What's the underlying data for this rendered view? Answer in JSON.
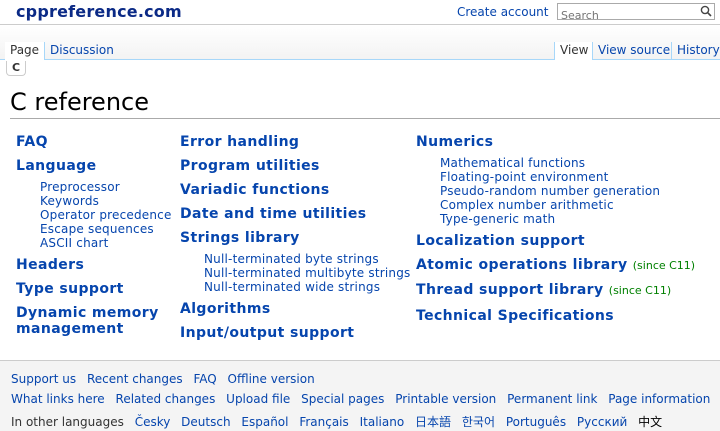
{
  "header": {
    "logo": "cppreference.com",
    "create_account": "Create account",
    "search_placeholder": "Search"
  },
  "tabs": {
    "left": [
      "Page",
      "Discussion"
    ],
    "right": [
      "View",
      "View source",
      "History"
    ],
    "active_left": "Page",
    "active_right": "View"
  },
  "breadcrumb": "C",
  "title": "C reference",
  "columns": {
    "col1": {
      "faq": "FAQ",
      "language": "Language",
      "language_items": [
        "Preprocessor",
        "Keywords",
        "Operator precedence",
        "Escape sequences",
        "ASCII chart"
      ],
      "headers": "Headers",
      "type_support": "Type support",
      "dynamic_memory_1": "Dynamic memory",
      "dynamic_memory_2": "management"
    },
    "col2": {
      "error_handling": "Error handling",
      "program_utilities": "Program utilities",
      "variadic": "Variadic functions",
      "date_time": "Date and time utilities",
      "strings": "Strings library",
      "strings_items": [
        "Null-terminated byte strings",
        "Null-terminated multibyte strings",
        "Null-terminated wide strings"
      ],
      "algorithms": "Algorithms",
      "io": "Input/output support"
    },
    "col3": {
      "numerics": "Numerics",
      "numerics_items": [
        "Mathematical functions",
        "Floating-point environment",
        "Pseudo-random number generation",
        "Complex number arithmetic",
        "Type-generic math"
      ],
      "localization": "Localization support",
      "atomic": "Atomic operations library",
      "atomic_since": "(since C11)",
      "thread": "Thread support library",
      "thread_since": "(since C11)",
      "techspec": "Technical Specifications"
    }
  },
  "footer": {
    "row1": [
      "Support us",
      "Recent changes",
      "FAQ",
      "Offline version"
    ],
    "row2": [
      "What links here",
      "Related changes",
      "Upload file",
      "Special pages",
      "Printable version",
      "Permanent link",
      "Page information"
    ],
    "row3_label": "In other languages",
    "row3": [
      "Česky",
      "Deutsch",
      "Español",
      "Français",
      "Italiano",
      "日本語",
      "한국어",
      "Português",
      "Русский",
      "中文"
    ]
  },
  "colors": {
    "link": "#0645ad",
    "since": "#008000",
    "logo": "#0b2a86"
  }
}
